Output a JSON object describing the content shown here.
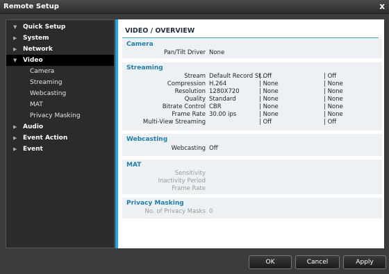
{
  "window": {
    "title": "Remote Setup",
    "close_label": "x"
  },
  "sidebar": {
    "items": [
      {
        "label": "Quick Setup",
        "arrow": "▼"
      },
      {
        "label": "System",
        "arrow": "▶"
      },
      {
        "label": "Network",
        "arrow": "▶"
      },
      {
        "label": "Video",
        "arrow": "▼"
      },
      {
        "label": "Audio",
        "arrow": "▶"
      },
      {
        "label": "Event Action",
        "arrow": "▶"
      },
      {
        "label": "Event",
        "arrow": "▶"
      }
    ],
    "video_sub": [
      "Camera",
      "Streaming",
      "Webcasting",
      "MAT",
      "Privacy Masking"
    ]
  },
  "main": {
    "title": "VIDEO / OVERVIEW",
    "camera": {
      "title": "Camera",
      "pan_tilt_label": "Pan/Tilt Driver",
      "pan_tilt_value": "None"
    },
    "streaming": {
      "title": "Streaming",
      "rows": [
        {
          "label": "Stream",
          "v1": "Default Record St...",
          "v2": "| Off",
          "v3": "| Off"
        },
        {
          "label": "Compression",
          "v1": "H.264",
          "v2": "| None",
          "v3": "| None"
        },
        {
          "label": "Resolution",
          "v1": "1280X720",
          "v2": "| None",
          "v3": "| None"
        },
        {
          "label": "Quality",
          "v1": "Standard",
          "v2": "| None",
          "v3": "| None"
        },
        {
          "label": "Bitrate Control",
          "v1": "CBR",
          "v2": "| None",
          "v3": "| None"
        },
        {
          "label": "Frame Rate",
          "v1": "30.00 ips",
          "v2": "| None",
          "v3": "| None"
        },
        {
          "label": "Multi-View Streaming",
          "v1": "",
          "v2": "| Off",
          "v3": "| Off"
        }
      ]
    },
    "webcasting": {
      "title": "Webcasting",
      "label": "Webcasting",
      "value": "Off"
    },
    "mat": {
      "title": "MAT",
      "rows": [
        "Sensitivity",
        "Inactivity Period",
        "Frame Rate"
      ]
    },
    "privacy": {
      "title": "Privacy Masking",
      "label": "No. of Privacy Masks",
      "value": "0"
    }
  },
  "footer": {
    "ok": "OK",
    "cancel": "Cancel",
    "apply": "Apply"
  }
}
